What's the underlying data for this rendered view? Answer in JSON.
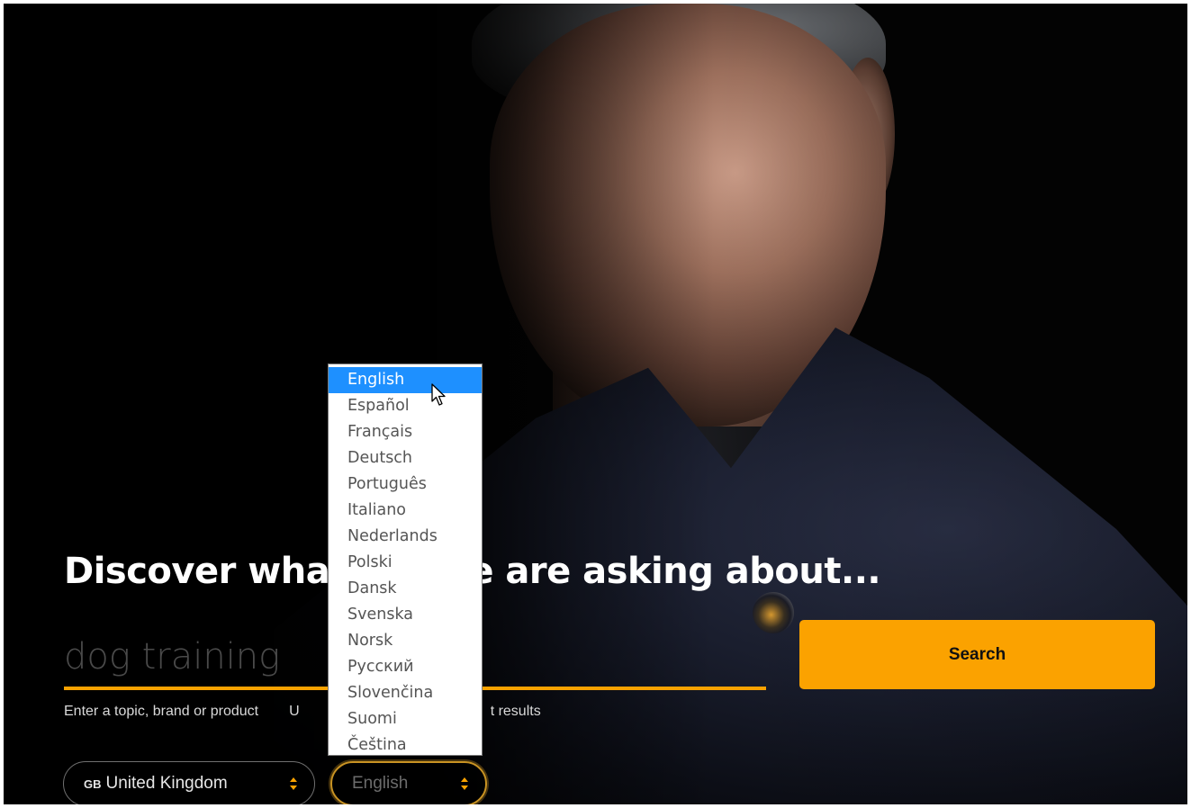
{
  "hero": {
    "headline": "Discover what people are asking about..."
  },
  "search": {
    "placeholder": "dog training",
    "button_label": "Search",
    "hint_left": "Enter a topic, brand or product",
    "hint_mid": "U",
    "hint_right": "t results"
  },
  "country_select": {
    "flag_code": "GB",
    "value": "United Kingdom"
  },
  "language_select": {
    "value": "English",
    "options": [
      "English",
      "Español",
      "Français",
      "Deutsch",
      "Português",
      "Italiano",
      "Nederlands",
      "Polski",
      "Dansk",
      "Svenska",
      "Norsk",
      "Русский",
      "Slovenčina",
      "Suomi",
      "Čeština"
    ],
    "selected_index": 0
  },
  "colors": {
    "accent": "#fba200",
    "highlight": "#1e90ff",
    "background": "#030303"
  },
  "icons": {
    "select_arrows": "chevron-up-down-icon",
    "cursor": "mouse-pointer-icon"
  }
}
